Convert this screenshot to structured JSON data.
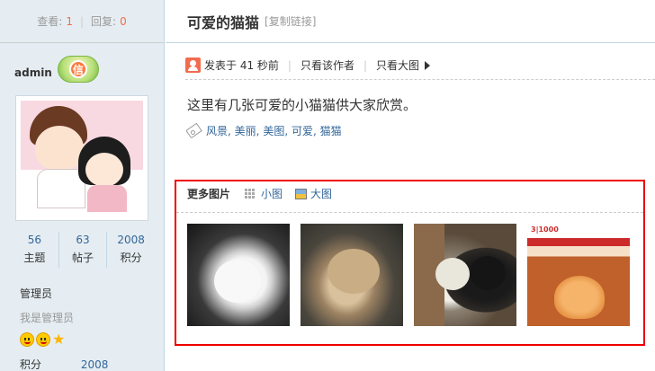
{
  "sidebar": {
    "stats": {
      "views_label": "查看:",
      "views_value": "1",
      "replies_label": "回复:",
      "replies_value": "0"
    },
    "author": {
      "name": "admin",
      "badge_char": "信"
    },
    "user_stats": [
      {
        "value": "56",
        "label": "主题"
      },
      {
        "value": "63",
        "label": "帖子"
      },
      {
        "value": "2008",
        "label": "积分"
      }
    ],
    "role": "管理员",
    "role_desc": "我是管理员",
    "points_label": "积分",
    "points_value": "2008"
  },
  "post": {
    "title": "可爱的猫猫",
    "copy_link": "[复制链接]",
    "posted": "发表于 41 秒前",
    "only_author": "只看该作者",
    "only_big": "只看大图",
    "content": "这里有几张可爱的小猫猫供大家欣赏。",
    "tags": [
      "风景",
      "美丽",
      "美图",
      "可爱",
      "猫猫"
    ]
  },
  "gallery": {
    "title": "更多图片",
    "small_view": "小图",
    "big_view": "大图",
    "thumb4_banner": "3|1000"
  },
  "colors": {
    "accent_red": "#e00000",
    "link_blue": "#336699",
    "sidebar_bg": "#e5edf2"
  }
}
